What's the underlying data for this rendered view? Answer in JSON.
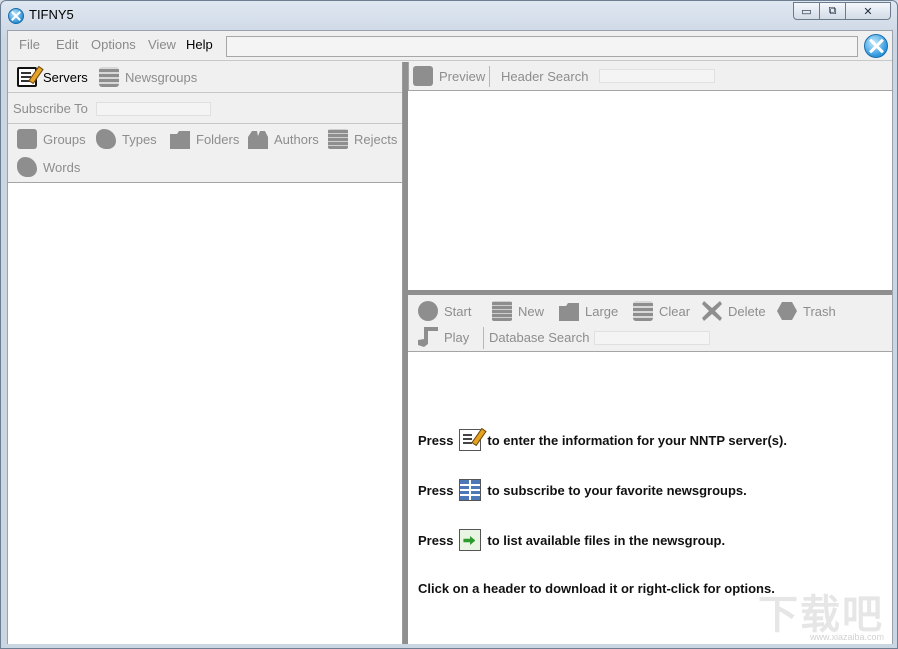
{
  "window": {
    "title": "TIFNY5",
    "minimize": "▭",
    "maximize": "⧉",
    "close": "✕"
  },
  "menubar": {
    "items": [
      "File",
      "Edit",
      "Options",
      "View",
      "Help"
    ],
    "search_value": ""
  },
  "left_toolbar": {
    "servers": "Servers",
    "newsgroups": "Newsgroups",
    "subscribe_to": "Subscribe To",
    "filters": [
      "Groups",
      "Types",
      "Folders",
      "Authors",
      "Rejects",
      "Words"
    ]
  },
  "top_toolbar": {
    "preview": "Preview",
    "header_search": "Header Search"
  },
  "bottom_toolbar": {
    "buttons": [
      "Start",
      "New",
      "Large",
      "Clear",
      "Delete",
      "Trash",
      "Play"
    ],
    "database_search": "Database Search"
  },
  "help": {
    "press": "Press",
    "line1": "to enter the information for your NNTP server(s).",
    "line2": "to subscribe to your favorite newsgroups.",
    "line3": "to list available files in the newsgroup.",
    "line4": "Click on a header to download it or right-click for options."
  },
  "watermark": {
    "text": "下载吧",
    "url": "www.xiazaiba.com"
  },
  "colors": {
    "disabled_text": "#8d8d8d",
    "splitter": "#8f8f8f",
    "toolbar_bg": "#f0f0f0"
  }
}
